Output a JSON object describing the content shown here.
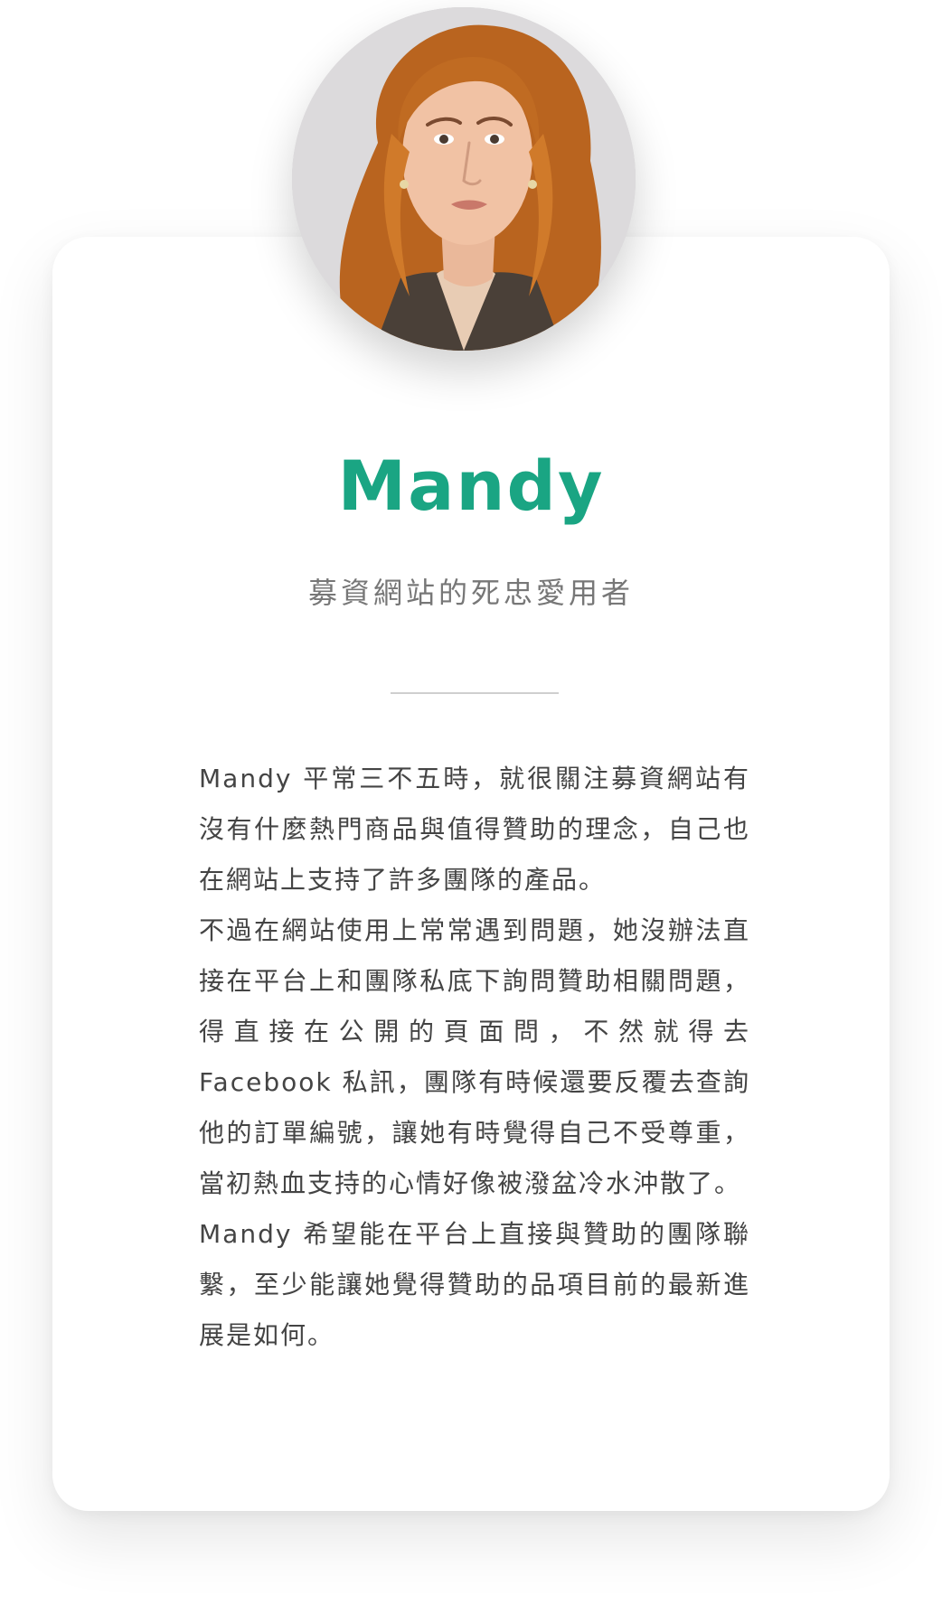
{
  "profile": {
    "avatar_alt": "Mandy avatar",
    "name": "Mandy",
    "tagline": "募資網站的死忠愛用者",
    "bio": [
      "Mandy 平常三不五時，就很關注募資網站有沒有什麼熱門商品與值得贊助的理念，自己也在網站上支持了許多團隊的產品。",
      "不過在網站使用上常常遇到問題，她沒辦法直接在平台上和團隊私底下詢問贊助相關問題，得直接在公開的頁面問，不然就得去 Facebook 私訊，團隊有時候還要反覆去查詢他的訂單編號，讓她有時覺得自己不受尊重，當初熱血支持的心情好像被潑盆冷水沖散了。",
      "Mandy 希望能在平台上直接與贊助的團隊聯繫，至少能讓她覺得贊助的品項目前的最新進展是如何。"
    ]
  },
  "colors": {
    "name_accent": "#1aa583",
    "tagline": "#777777",
    "body_text": "#444444"
  }
}
